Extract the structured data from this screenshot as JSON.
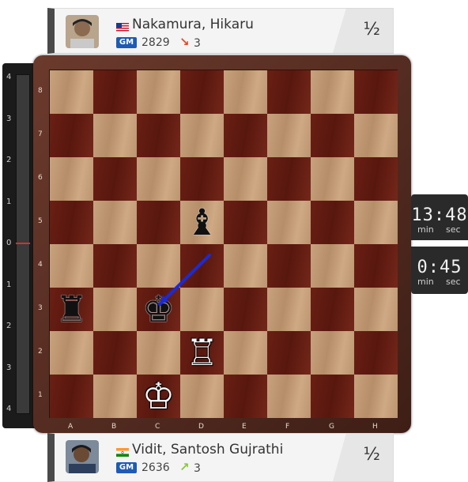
{
  "top_player": {
    "name": "Nakamura, Hikaru",
    "flag_icon": "usa-flag-icon",
    "title": "GM",
    "rating": "2829",
    "rating_change": "3",
    "rating_change_direction": "down",
    "rating_change_color": "#e04a2f",
    "result": "½"
  },
  "bottom_player": {
    "name": "Vidit, Santosh Gujrathi",
    "flag_icon": "india-flag-icon",
    "title": "GM",
    "rating": "2636",
    "rating_change": "3",
    "rating_change_direction": "up",
    "rating_change_color": "#8cc63f",
    "result": "½"
  },
  "clocks": {
    "top": {
      "time": "13:48",
      "min_label": "min",
      "sec_label": "sec"
    },
    "bottom": {
      "time": "0:45",
      "min_label": "min",
      "sec_label": "sec"
    }
  },
  "eval_bar": {
    "ticks": [
      "4",
      "3",
      "2",
      "1",
      "0",
      "1",
      "2",
      "3",
      "4"
    ],
    "current_value": 0
  },
  "board": {
    "files": [
      "A",
      "B",
      "C",
      "D",
      "E",
      "F",
      "G",
      "H"
    ],
    "ranks": [
      "8",
      "7",
      "6",
      "5",
      "4",
      "3",
      "2",
      "1"
    ],
    "pieces": [
      {
        "square": "d5",
        "piece": "bishop",
        "color": "black",
        "glyph": "♝"
      },
      {
        "square": "a3",
        "piece": "rook",
        "color": "black",
        "glyph": "♜"
      },
      {
        "square": "c3",
        "piece": "king",
        "color": "black",
        "glyph": "♚"
      },
      {
        "square": "d2",
        "piece": "rook",
        "color": "white",
        "glyph": "♖"
      },
      {
        "square": "c1",
        "piece": "king",
        "color": "white",
        "glyph": "♔"
      }
    ],
    "arrow": {
      "from": "d4",
      "to": "c3",
      "color": "#1a2bd6"
    }
  }
}
